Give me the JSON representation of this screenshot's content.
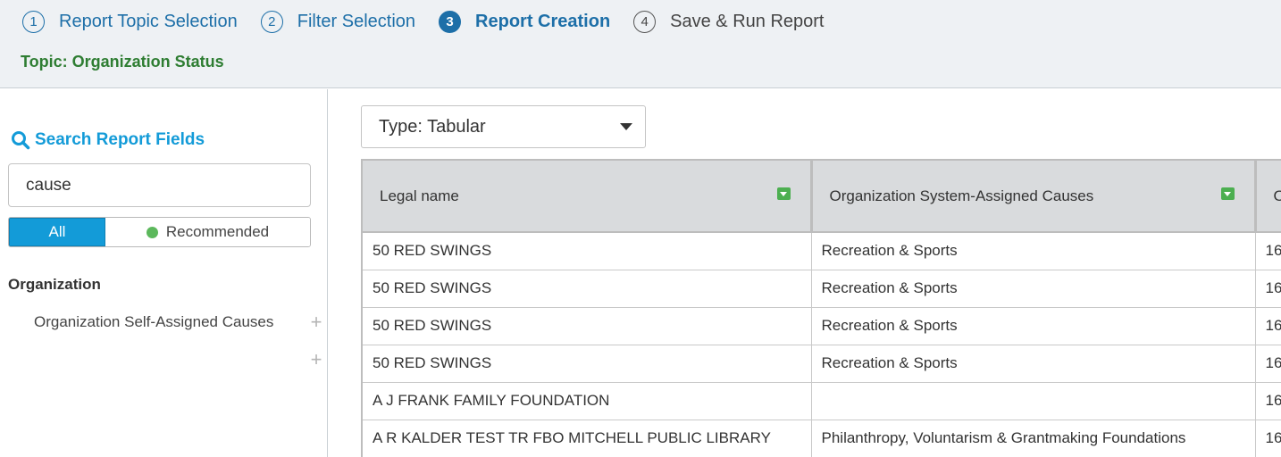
{
  "wizard": {
    "steps": [
      {
        "num": "1",
        "label": "Report Topic Selection"
      },
      {
        "num": "2",
        "label": "Filter Selection"
      },
      {
        "num": "3",
        "label": "Report Creation"
      },
      {
        "num": "4",
        "label": "Save & Run Report"
      }
    ],
    "topic": "Topic: Organization Status"
  },
  "sidebar": {
    "search_title": "Search Report Fields",
    "search_value": "cause",
    "toggle": {
      "all": "All",
      "recommended": "Recommended"
    },
    "group": "Organization",
    "fields": [
      "Organization Self-Assigned Causes",
      ""
    ]
  },
  "main": {
    "type_select": "Type: Tabular",
    "columns": [
      "Legal name",
      "Organization System-Assigned Causes",
      "O"
    ],
    "rows": [
      [
        "50 RED SWINGS",
        "Recreation & Sports",
        "16"
      ],
      [
        "50 RED SWINGS",
        "Recreation & Sports",
        "16"
      ],
      [
        "50 RED SWINGS",
        "Recreation & Sports",
        "16"
      ],
      [
        "50 RED SWINGS",
        "Recreation & Sports",
        "16"
      ],
      [
        "A J FRANK FAMILY FOUNDATION",
        "",
        "16"
      ],
      [
        "A R KALDER TEST TR FBO MITCHELL PUBLIC LIBRARY",
        "Philanthropy, Voluntarism & Grantmaking Foundations",
        "16"
      ]
    ]
  },
  "colors": {
    "accent": "#139bd8",
    "step_blue": "#1d6fa8",
    "topic_green": "#2e7d32",
    "sort_green": "#4caf50"
  }
}
